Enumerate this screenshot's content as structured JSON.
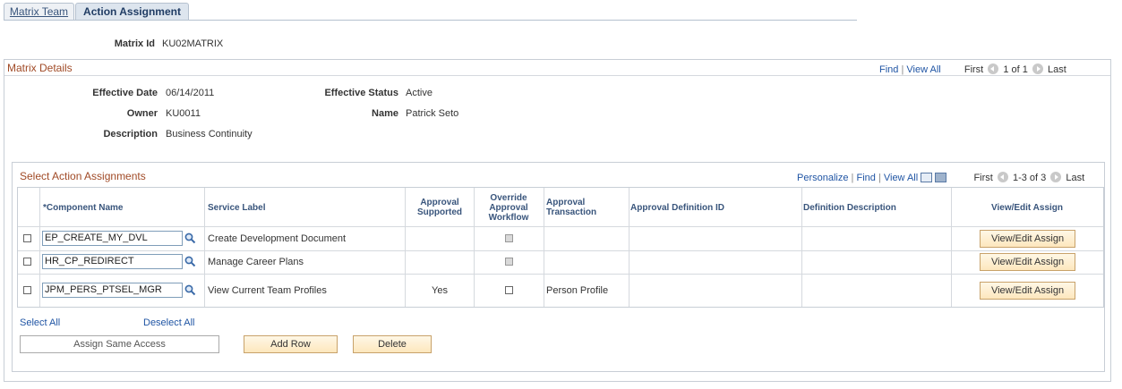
{
  "tabs": [
    {
      "label": "Matrix Team",
      "active": false
    },
    {
      "label": "Action Assignment",
      "active": true
    }
  ],
  "matrix_id": {
    "label": "Matrix Id",
    "value": "KU02MATRIX"
  },
  "matrix_details": {
    "title": "Matrix Details",
    "nav": {
      "find": "Find",
      "sep": "|",
      "view_all": "View All",
      "first": "First",
      "range": "1 of 1",
      "last": "Last"
    },
    "fields": {
      "effective_date": {
        "label": "Effective Date",
        "value": "06/14/2011"
      },
      "effective_status": {
        "label": "Effective Status",
        "value": "Active"
      },
      "owner": {
        "label": "Owner",
        "value": "KU0011"
      },
      "name": {
        "label": "Name",
        "value": "Patrick Seto"
      },
      "description": {
        "label": "Description",
        "value": "Business Continuity"
      }
    }
  },
  "action_assignments": {
    "title": "Select Action Assignments",
    "nav": {
      "personalize": "Personalize",
      "sep": "|",
      "find": "Find",
      "view_all": "View All",
      "first": "First",
      "range": "1-3 of 3",
      "last": "Last"
    },
    "columns": {
      "component": "*Component Name",
      "service": "Service Label",
      "approval_supported": "Approval Supported",
      "override": "Override Approval Workflow",
      "approval_txn": "Approval Transaction",
      "approval_def": "Approval Definition ID",
      "def_desc": "Definition Description",
      "view_edit": "View/Edit Assign"
    },
    "rows": [
      {
        "component": "EP_CREATE_MY_DVL",
        "service": "Create Development Document",
        "approval_supported": "",
        "override_disabled": true,
        "approval_txn": "",
        "button": "View/Edit Assign"
      },
      {
        "component": "HR_CP_REDIRECT",
        "service": "Manage Career Plans",
        "approval_supported": "",
        "override_disabled": true,
        "approval_txn": "",
        "button": "View/Edit Assign"
      },
      {
        "component": "JPM_PERS_PTSEL_MGR",
        "service": "View Current Team Profiles",
        "approval_supported": "Yes",
        "override_disabled": false,
        "approval_txn": "Person Profile",
        "button": "View/Edit Assign"
      }
    ]
  },
  "actions": {
    "select_all": "Select All",
    "deselect_all": "Deselect All",
    "assign_same_access": "Assign Same Access",
    "add_row": "Add Row",
    "delete": "Delete"
  }
}
